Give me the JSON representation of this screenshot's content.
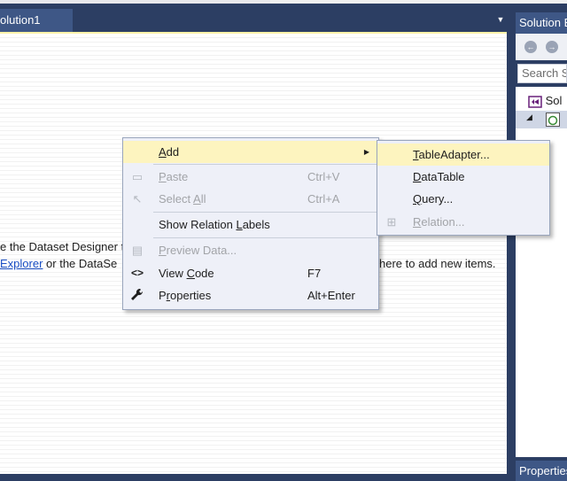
{
  "document_tab": {
    "title": "olution1",
    "dropdown_icon": "▼"
  },
  "designer": {
    "hint_line1": "e the Dataset Designer t",
    "hint_line2_link": "Explorer",
    "hint_line2_text": " or the DataSe",
    "hint_line2_right": "here to add new items."
  },
  "solution_explorer": {
    "title": "Solution E",
    "search_placeholder": "Search S",
    "back_icon": "←",
    "forward_icon": "→",
    "row1_label": "Sol",
    "expander_icon": "◢"
  },
  "properties_panel": {
    "title": "Properties"
  },
  "context_menu": {
    "items": [
      {
        "id": "add",
        "pre": "",
        "u": "A",
        "post": "dd",
        "shortcut": "",
        "icon": "",
        "has_submenu": true,
        "highlighted": true,
        "disabled": false
      },
      {
        "id": "paste",
        "pre": "",
        "u": "P",
        "post": "aste",
        "shortcut": "Ctrl+V",
        "icon": "▭",
        "disabled": true
      },
      {
        "id": "select-all",
        "pre": "Select ",
        "u": "A",
        "post": "ll",
        "shortcut": "Ctrl+A",
        "icon": "↖",
        "disabled": true
      },
      {
        "id": "show-relation-labels",
        "pre": "Show Relation ",
        "u": "L",
        "post": "abels",
        "shortcut": "",
        "icon": "",
        "disabled": false
      },
      {
        "id": "preview-data",
        "pre": "",
        "u": "P",
        "post": "review Data...",
        "shortcut": "",
        "icon": "▤",
        "disabled": true
      },
      {
        "id": "view-code",
        "pre": "View ",
        "u": "C",
        "post": "ode",
        "shortcut": "F7",
        "icon": "<>",
        "disabled": false
      },
      {
        "id": "properties",
        "pre": "P",
        "u": "r",
        "post": "operties",
        "shortcut": "Alt+Enter",
        "icon": "🔧",
        "disabled": false
      }
    ]
  },
  "add_submenu": {
    "items": [
      {
        "id": "table-adapter",
        "pre": "",
        "u": "T",
        "post": "ableAdapter...",
        "highlighted": true,
        "disabled": false
      },
      {
        "id": "data-table",
        "pre": "",
        "u": "D",
        "post": "ataTable",
        "disabled": false
      },
      {
        "id": "query",
        "pre": "",
        "u": "Q",
        "post": "uery...",
        "disabled": false
      },
      {
        "id": "relation",
        "pre": "",
        "u": "R",
        "post": "elation...",
        "disabled": true,
        "icon": "⊞"
      }
    ]
  },
  "colors": {
    "frame": "#2c3e63",
    "tab_active": "#3e5786",
    "menu_bg": "#eef0f8",
    "menu_highlight": "#fdf4bf",
    "link": "#1a4fc4"
  }
}
